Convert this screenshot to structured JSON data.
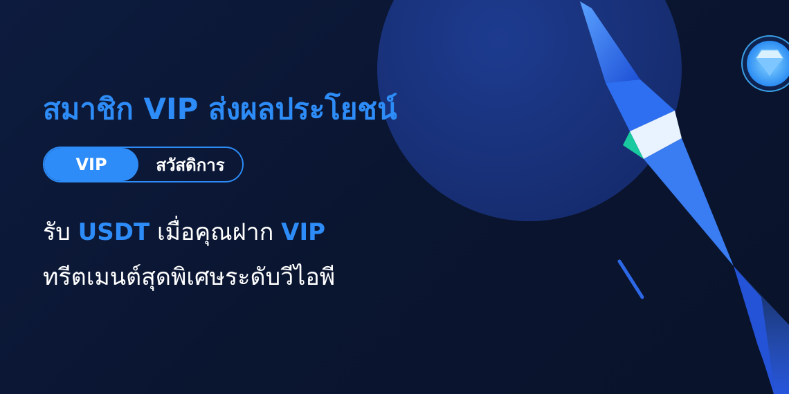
{
  "headline": "สมาชิก VIP ส่งผลประโยชน์",
  "tabs": {
    "active": "VIP",
    "inactive": "สวัสดิการ"
  },
  "line1": {
    "part1": "รับ ",
    "highlight1": "USDT",
    "part2": " เมื่อคุณฝาก ",
    "highlight2": "VIP"
  },
  "line2": "ทรีตเมนต์สุดพิเศษระดับวีไอพี",
  "colors": {
    "background": "#0a1530",
    "accent": "#2d8cf7",
    "text": "#ffffff",
    "teal": "#19c9a0"
  },
  "icons": {
    "diamond_badge": "diamond-badge-icon",
    "rocket": "rocket-illustration"
  }
}
